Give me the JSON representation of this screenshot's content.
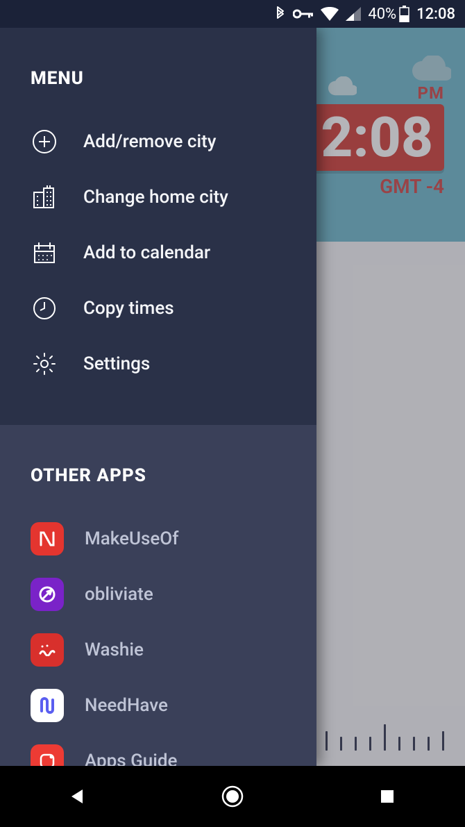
{
  "status": {
    "battery_pct": "40%",
    "clock": "12:08"
  },
  "background": {
    "pm": "PM",
    "time": "2:08",
    "gmt": "GMT -4"
  },
  "drawer": {
    "menu_title": "MENU",
    "items": [
      {
        "label": "Add/remove city"
      },
      {
        "label": "Change home city"
      },
      {
        "label": "Add to calendar"
      },
      {
        "label": "Copy times"
      },
      {
        "label": "Settings"
      }
    ],
    "other_title": "OTHER APPS",
    "apps": [
      {
        "label": "MakeUseOf",
        "bg": "#e4352f",
        "fg": "#ffffff"
      },
      {
        "label": "obliviate",
        "bg": "#7a23c8",
        "fg": "#ffffff"
      },
      {
        "label": "Washie",
        "bg": "#d8302c",
        "fg": "#ffffff"
      },
      {
        "label": "NeedHave",
        "bg": "#ffffff",
        "fg": "#5a5ef0"
      },
      {
        "label": "Apps Guide",
        "bg": "#ed3b34",
        "fg": "#ffffff"
      }
    ]
  }
}
